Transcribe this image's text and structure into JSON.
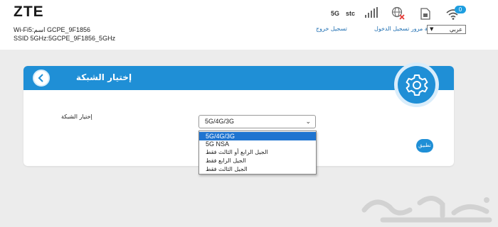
{
  "header": {
    "logo": "ZTE",
    "ssid_line1": "Wi-Fi5:اسم GCPE_9F1856",
    "ssid_line2": "SSID 5GHz:5GCPE_9F1856_5GHz",
    "network_type": "5G",
    "operator": "stc",
    "wifi_clients": "0",
    "links": {
      "change_password": "تعديل كلمة مرور تسجيل الدخول",
      "logout": "تسجيل خروج"
    },
    "language": "عربي",
    "icons": [
      "signal-icon",
      "globe-no-connection-icon",
      "sim-card-icon",
      "wifi-icon"
    ]
  },
  "card": {
    "title": "إختيار الشبكة",
    "field_label": "إختيار الشبكة",
    "selected_value": "5G/4G/3G",
    "options": [
      "5G/4G/3G",
      "5G NSA",
      "الجيل الرابع أو الثالث فقط",
      "الجيل الرابع فقط",
      "الجيل الثالث فقط"
    ],
    "apply_label": "تطبيق"
  },
  "colors": {
    "accent": "#1f8fd6",
    "selected_option": "#1f74d0",
    "link": "#1f6fb2"
  }
}
